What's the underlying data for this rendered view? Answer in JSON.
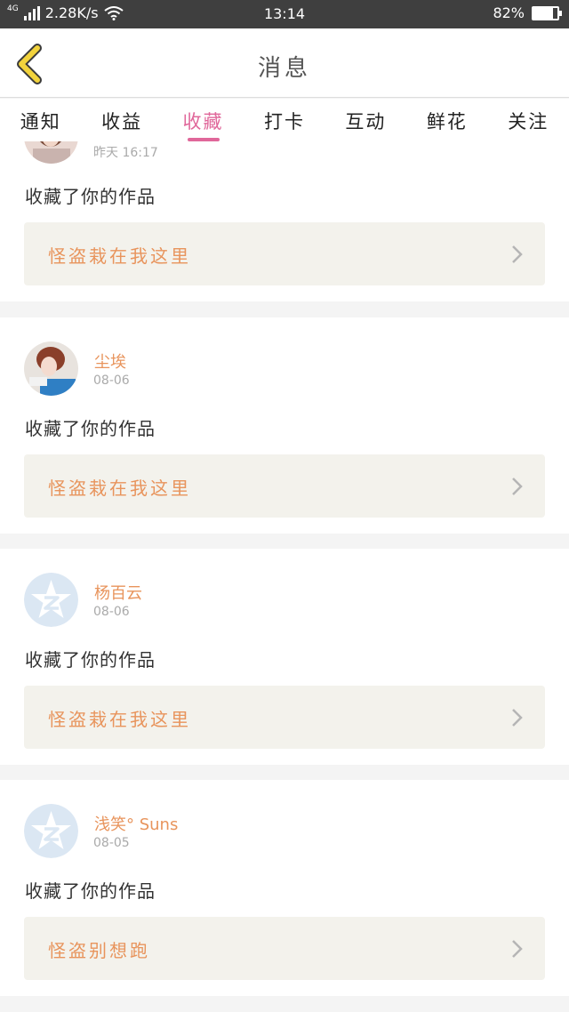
{
  "status_bar": {
    "network_type": "4G",
    "speed": "2.28K/s",
    "time": "13:14",
    "battery": "82%",
    "battery_level": 0.82
  },
  "header": {
    "title": "消息"
  },
  "tabs": [
    {
      "label": "通知",
      "active": false
    },
    {
      "label": "收益",
      "active": false
    },
    {
      "label": "收藏",
      "active": true
    },
    {
      "label": "打卡",
      "active": false
    },
    {
      "label": "互动",
      "active": false
    },
    {
      "label": "鲜花",
      "active": false
    },
    {
      "label": "关注",
      "active": false
    }
  ],
  "notifications": [
    {
      "date": "昨天 16:17",
      "action": "收藏了你的作品",
      "work_title": "怪盗栽在我这里",
      "avatar": "photo-avatar"
    },
    {
      "username": "尘埃",
      "date": "08-06",
      "action": "收藏了你的作品",
      "work_title": "怪盗栽在我这里",
      "avatar": "photo-avatar"
    },
    {
      "username": "杨百云",
      "date": "08-06",
      "action": "收藏了你的作品",
      "work_title": "怪盗栽在我这里",
      "avatar": "default-star-avatar"
    },
    {
      "username": "浅笑° Suns",
      "date": "08-05",
      "action": "收藏了你的作品",
      "work_title": "怪盗别想跑",
      "avatar": "default-star-avatar"
    }
  ],
  "colors": {
    "accent_tab": "#e0679a",
    "username": "#e8945c",
    "card_link_bg": "#f3f2ec",
    "back_arrow": "#f2d33c"
  }
}
